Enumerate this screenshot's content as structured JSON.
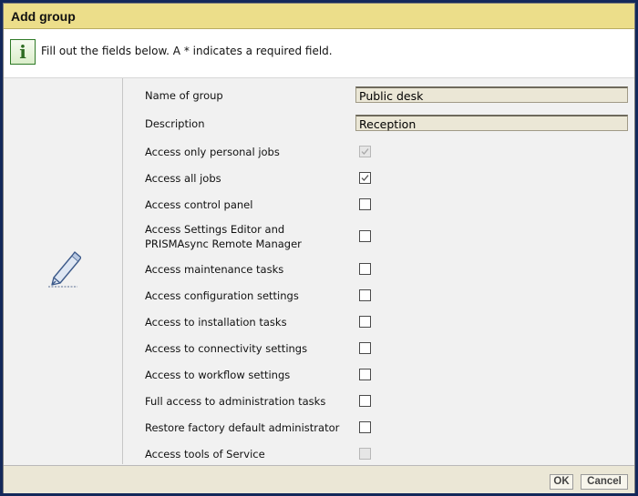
{
  "dialog": {
    "title": "Add group",
    "info_icon": "info-icon",
    "info_text": "Fill out the fields below. A * indicates a required field.",
    "side_icon": "pencil-edit-icon"
  },
  "fields": {
    "name": {
      "label": "Name of group",
      "value": "Public desk"
    },
    "description": {
      "label": "Description",
      "value": "Reception"
    }
  },
  "permissions": [
    {
      "label": "Access only personal jobs",
      "checked": true,
      "disabled": true
    },
    {
      "label": "Access all jobs",
      "checked": true,
      "disabled": false
    },
    {
      "label": "Access control panel",
      "checked": false,
      "disabled": false
    },
    {
      "label_line1": "Access Settings Editor and",
      "label_line2": "PRISMAsync Remote Manager",
      "checked": false,
      "disabled": false
    },
    {
      "label": "Access maintenance tasks",
      "checked": false,
      "disabled": false
    },
    {
      "label": "Access configuration settings",
      "checked": false,
      "disabled": false
    },
    {
      "label": "Access to installation tasks",
      "checked": false,
      "disabled": false
    },
    {
      "label": "Access to connectivity settings",
      "checked": false,
      "disabled": false
    },
    {
      "label": "Access to workflow settings",
      "checked": false,
      "disabled": false
    },
    {
      "label": "Full access to administration tasks",
      "checked": false,
      "disabled": false
    },
    {
      "label": "Restore factory default administrator",
      "checked": false,
      "disabled": false
    },
    {
      "label": "Access tools of Service",
      "checked": false,
      "disabled": true
    }
  ],
  "buttons": {
    "ok": "OK",
    "cancel": "Cancel"
  },
  "colors": {
    "title_bar": "#ecde8a",
    "background": "#13285a",
    "input_fill": "#ebe7d6",
    "info_icon": "#2d6b22"
  }
}
